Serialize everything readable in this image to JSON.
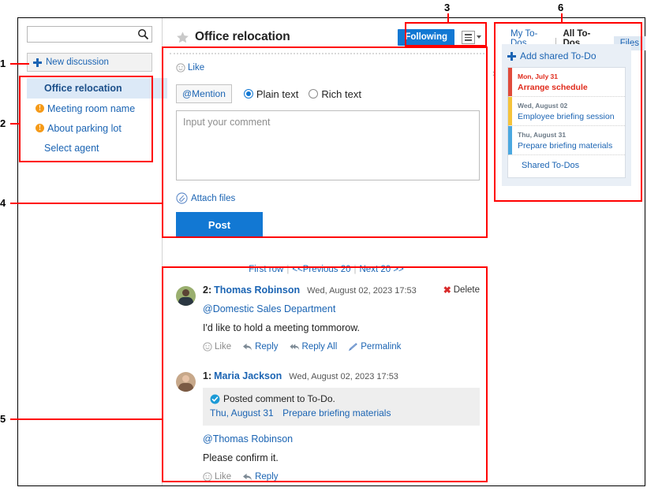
{
  "window": {
    "frame_color": "#000000",
    "annotation_color": "#ff0000"
  },
  "sidebar": {
    "search": {
      "value": "",
      "placeholder": "",
      "icon": "search-icon"
    },
    "new_discussion": {
      "label": "New discussion",
      "icon": "plus-icon"
    },
    "discussions": [
      {
        "label": "Office relocation",
        "current": true,
        "badge": false
      },
      {
        "label": "Meeting room name",
        "current": false,
        "badge": true
      },
      {
        "label": "About parking lot",
        "current": false,
        "badge": true
      },
      {
        "label": "Select agent",
        "current": false,
        "badge": false
      }
    ]
  },
  "main": {
    "star_icon": "star-icon",
    "title": "Office relocation",
    "following_label": "Following",
    "menu_icon": "hamburger-menu-icon",
    "like": {
      "icon": "smiley-icon",
      "label": "Like"
    },
    "composer": {
      "mention_label": "@Mention",
      "format_options": [
        {
          "label": "Plain text",
          "selected": true
        },
        {
          "label": "Rich text",
          "selected": false
        }
      ],
      "comment_value": "",
      "comment_placeholder": "Input your comment",
      "attach_label": "Attach files",
      "attach_icon": "paperclip-icon",
      "post_label": "Post"
    },
    "pager": {
      "first": "First row",
      "prev": "<<Previous 20",
      "next": "Next 20 >>",
      "separator": "|"
    },
    "comments": [
      {
        "number": "2:",
        "author": "Thomas Robinson",
        "date": "Wed, August 02, 2023 17:53",
        "delete_label": "Delete",
        "mention": "@Domestic Sales Department",
        "text": "I'd like to hold a meeting tommorow.",
        "actions": [
          {
            "label": "Like",
            "icon": "smiley-icon",
            "muted": true
          },
          {
            "label": "Reply",
            "icon": "reply-arrow-icon",
            "muted": false
          },
          {
            "label": "Reply All",
            "icon": "reply-all-arrow-icon",
            "muted": false
          },
          {
            "label": "Permalink",
            "icon": "permalink-icon",
            "muted": false
          }
        ]
      },
      {
        "number": "1:",
        "author": "Maria Jackson",
        "date": "Wed, August 02, 2023 17:53",
        "delete_label": "",
        "quote": {
          "icon": "check-circle-icon",
          "line1": "Posted comment to To-Do.",
          "date": "Thu, August 31",
          "title": "Prepare briefing materials"
        },
        "mention": "@Thomas Robinson",
        "text": "Please confirm it.",
        "actions": [
          {
            "label": "Like",
            "icon": "smiley-icon",
            "muted": true
          },
          {
            "label": "Reply",
            "icon": "reply-arrow-icon",
            "muted": false
          }
        ]
      }
    ]
  },
  "todo_panel": {
    "tabs": [
      {
        "label": "My To-Dos",
        "active": false,
        "boxed": false
      },
      {
        "label": "All To-Dos",
        "active": true,
        "boxed": false
      },
      {
        "label": "Files",
        "active": false,
        "boxed": true
      }
    ],
    "add_label": "Add shared To-Do",
    "add_icon": "plus-icon",
    "collapse_icon": "chevron-right-icon",
    "items": [
      {
        "date": "Mon, July 31",
        "name": "Arrange schedule",
        "color": "red",
        "overdue": true
      },
      {
        "date": "Wed, August 02",
        "name": "Employee briefing session",
        "color": "yellow",
        "overdue": false
      },
      {
        "date": "Thu, August 31",
        "name": "Prepare briefing materials",
        "color": "blue",
        "overdue": false
      }
    ],
    "shared_label": "Shared To-Dos"
  },
  "annotations": {
    "numbers": [
      "1",
      "2",
      "3",
      "4",
      "5",
      "6"
    ]
  }
}
